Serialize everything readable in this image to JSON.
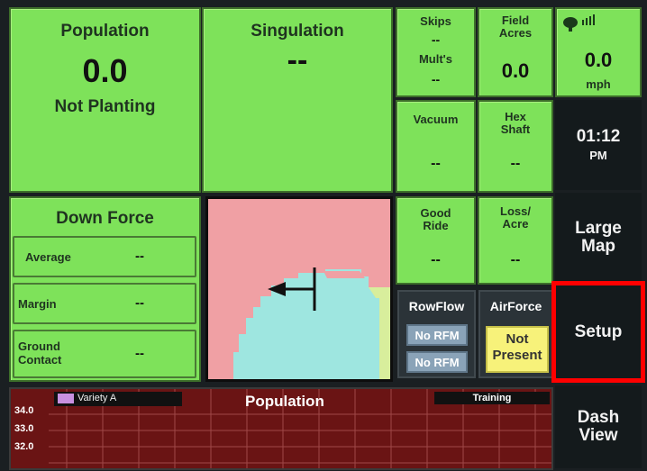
{
  "population": {
    "title": "Population",
    "value": "0.0",
    "status": "Not Planting"
  },
  "singulation": {
    "title": "Singulation",
    "value": "--"
  },
  "skips": {
    "label": "Skips",
    "value": "--",
    "mults_label": "Mult's",
    "mults_value": "--"
  },
  "field_acres": {
    "label": "Field\nAcres",
    "value": "0.0"
  },
  "speed": {
    "value": "0.0",
    "unit": "mph"
  },
  "vacuum": {
    "label": "Vacuum",
    "value": "--"
  },
  "hex_shaft": {
    "label": "Hex\nShaft",
    "value": "--"
  },
  "clock": {
    "time": "01:12",
    "ampm": "PM"
  },
  "down_force": {
    "title": "Down Force",
    "rows": [
      {
        "label": "Average",
        "value": "--"
      },
      {
        "label": "Margin",
        "value": "--"
      },
      {
        "label": "Ground\nContact",
        "value": "--"
      }
    ]
  },
  "good_ride": {
    "label": "Good\nRide",
    "value": "--"
  },
  "loss_acre": {
    "label": "Loss/\nAcre",
    "value": "--"
  },
  "rowflow": {
    "title": "RowFlow",
    "btn1": "No RFM",
    "btn2": "No RFM"
  },
  "airforce": {
    "title": "AirForce",
    "status": "Not\nPresent"
  },
  "side_buttons": {
    "large_map": "Large\nMap",
    "setup": "Setup",
    "dash_view": "Dash\nView"
  },
  "graph": {
    "title": "Population",
    "legend": "Variety A",
    "mode": "Training",
    "y_ticks": [
      "34.0",
      "33.0",
      "32.0"
    ]
  },
  "colors": {
    "tile_green": "#7ee25a",
    "map_pink": "#f0a0a4",
    "map_cyan": "#9ee6e0",
    "graph_bg": "#6a1414",
    "airforce_yellow": "#f7f27a",
    "highlight_red": "#ff0000"
  }
}
